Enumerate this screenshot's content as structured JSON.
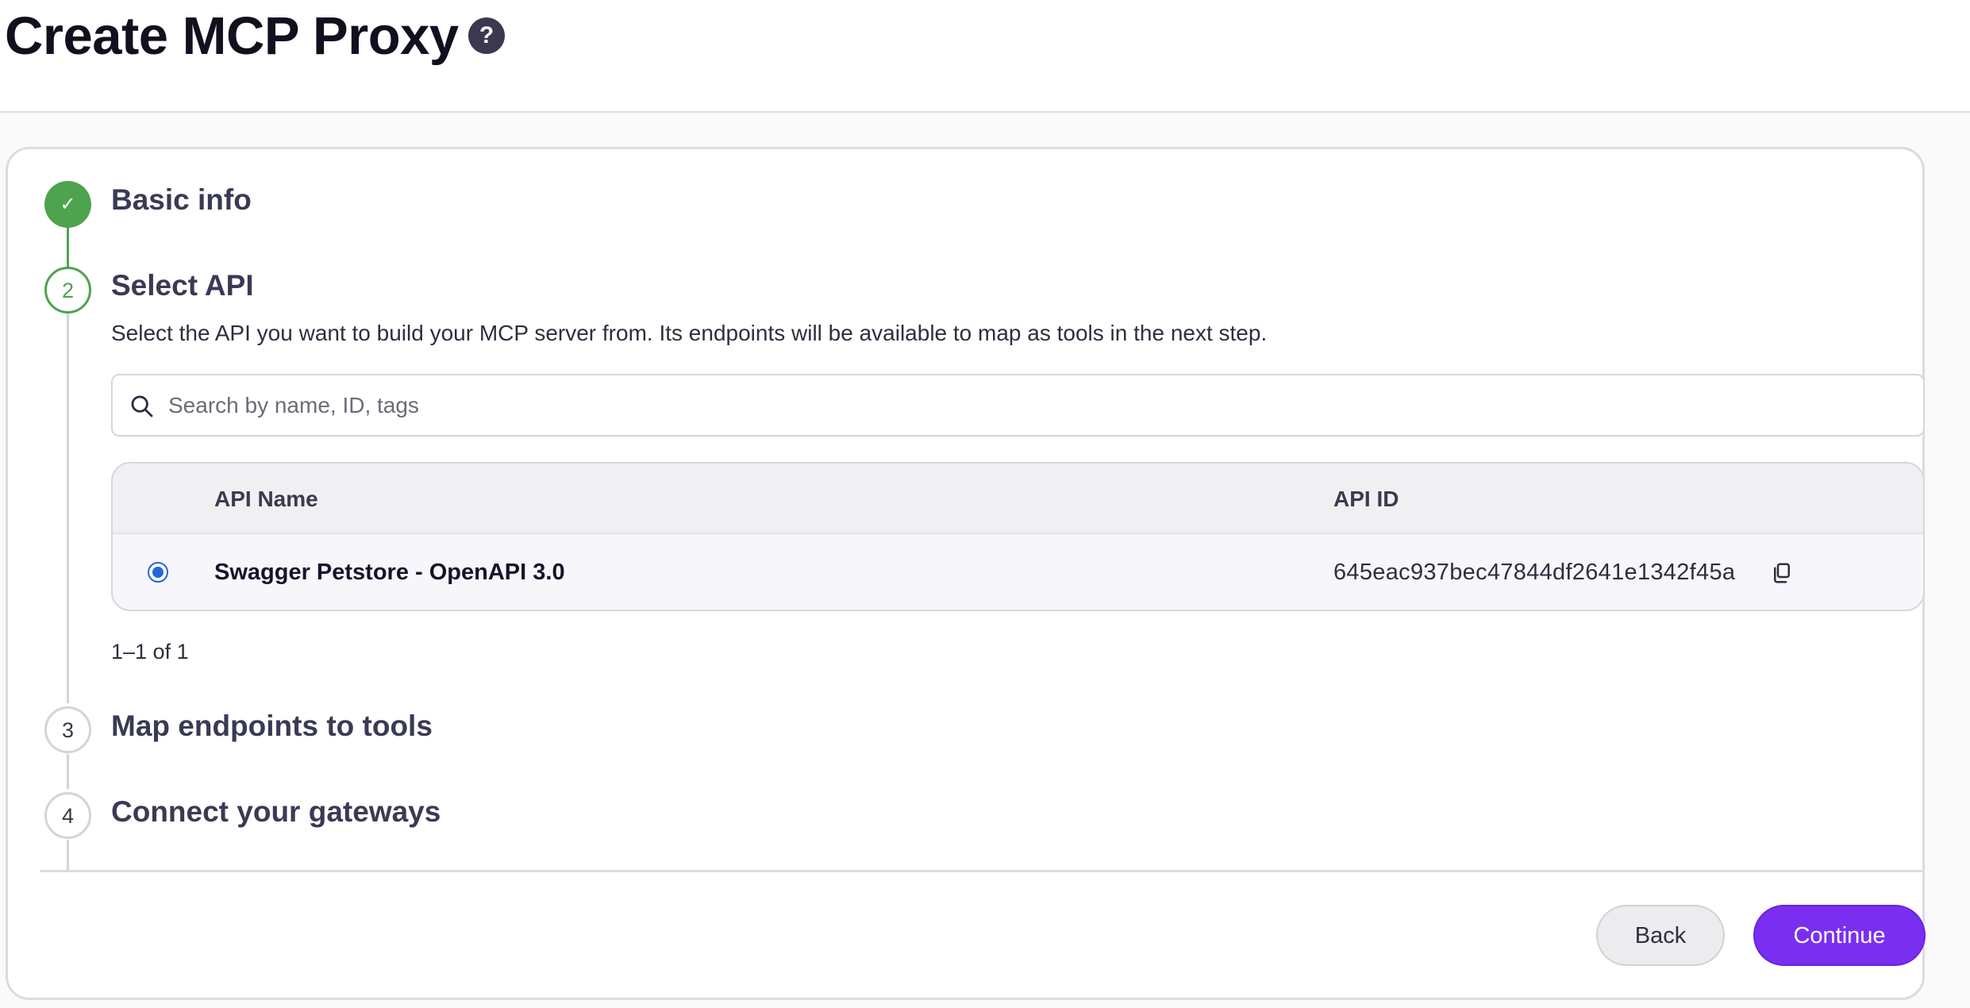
{
  "header": {
    "title": "Create MCP Proxy",
    "help_icon": "?"
  },
  "stepper": {
    "steps": [
      {
        "number": "✓",
        "title": "Basic info",
        "status": "completed"
      },
      {
        "number": "2",
        "title": "Select API",
        "status": "active"
      },
      {
        "number": "3",
        "title": "Map endpoints to tools",
        "status": "pending"
      },
      {
        "number": "4",
        "title": "Connect your gateways",
        "status": "pending"
      }
    ],
    "active_description": "Select the API you want to build your MCP server from. Its endpoints will be available to map as tools in the next step."
  },
  "search": {
    "placeholder": "Search by name, ID, tags",
    "value": ""
  },
  "table": {
    "columns": [
      "API Name",
      "API ID"
    ],
    "rows": [
      {
        "selected": true,
        "name": "Swagger Petstore - OpenAPI 3.0",
        "id": "645eac937bec47844df2641e1342f45a"
      }
    ]
  },
  "pagination": {
    "text": "1–1 of 1"
  },
  "footer": {
    "back_label": "Back",
    "continue_label": "Continue"
  },
  "colors": {
    "success": "#4ea34e",
    "primary": "#7a2ff0",
    "radio": "#2266dd"
  }
}
